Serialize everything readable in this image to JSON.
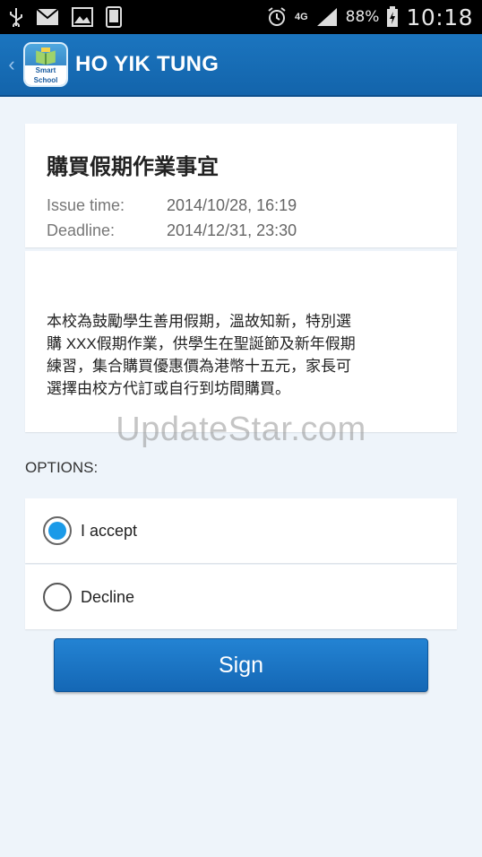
{
  "status_bar": {
    "icons": [
      "usb-icon",
      "mail-icon",
      "image-icon",
      "phone-icon",
      "alarm-icon",
      "network-4g-icon",
      "signal-icon",
      "battery-icon"
    ],
    "network_label": "4G",
    "battery_percent": "88%",
    "time": "10:18"
  },
  "app_bar": {
    "title": "HO YIK TUNG",
    "logo_text": "Smart School"
  },
  "notice": {
    "title": "購買假期作業事宜",
    "issue_label": "Issue time:",
    "issue_value": "2014/10/28, 16:19",
    "deadline_label": "Deadline:",
    "deadline_value": "2014/12/31, 23:30",
    "body_lines": [
      "本校為鼓勵學生善用假期，溫故知新，特別選",
      "購 XXX假期作業，供學生在聖誕節及新年假期",
      "練習，集合購買優惠價為港幣十五元，家長可",
      "選擇由校方代訂或自行到坊間購買。"
    ]
  },
  "options": {
    "label": "OPTIONS:",
    "items": [
      {
        "label": "I accept",
        "selected": true
      },
      {
        "label": "Decline",
        "selected": false
      }
    ]
  },
  "sign_button": "Sign",
  "watermark": "UpdateStar.com",
  "colors": {
    "app_bar": "#1b75bf",
    "accent": "#1a9ae8",
    "background": "#eef4fa"
  }
}
